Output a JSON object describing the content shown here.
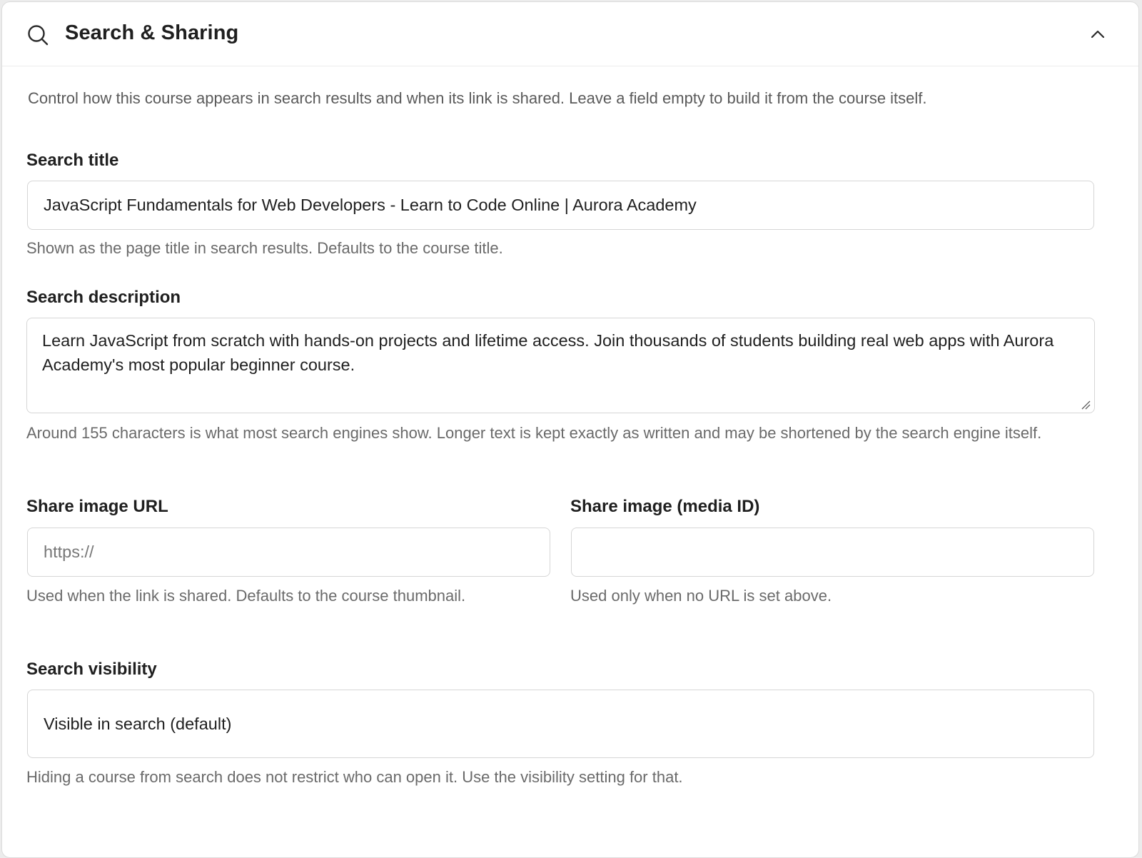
{
  "section": {
    "title": "Search & Sharing",
    "icon": "search-icon",
    "collapse_icon": "chevron-up-icon",
    "intro": "Control how this course appears in search results and when its link is shared. Leave a field empty to build it from the course itself."
  },
  "search_title": {
    "label": "Search title",
    "value": "JavaScript Fundamentals for Web Developers - Learn to Code Online | Aurora Academy",
    "help": "Shown as the page title in search results. Defaults to the course title."
  },
  "search_description": {
    "label": "Search description",
    "value": "Learn JavaScript from scratch with hands-on projects and lifetime access. Join thousands of students building real web apps with Aurora Academy's most popular beginner course.",
    "help": "Around 155 characters is what most search engines show. Longer text is kept exactly as written and may be shortened by the search engine itself."
  },
  "share_image_url": {
    "label": "Share image URL",
    "value": "",
    "placeholder": "https://",
    "help": "Used when the link is shared. Defaults to the course thumbnail."
  },
  "share_image_media": {
    "label": "Share image (media ID)",
    "value": "",
    "help": "Used only when no URL is set above."
  },
  "search_visibility": {
    "label": "Search visibility",
    "selected": "Visible in search (default)",
    "help": "Hiding a course from search does not restrict who can open it. Use the visibility setting for that."
  }
}
